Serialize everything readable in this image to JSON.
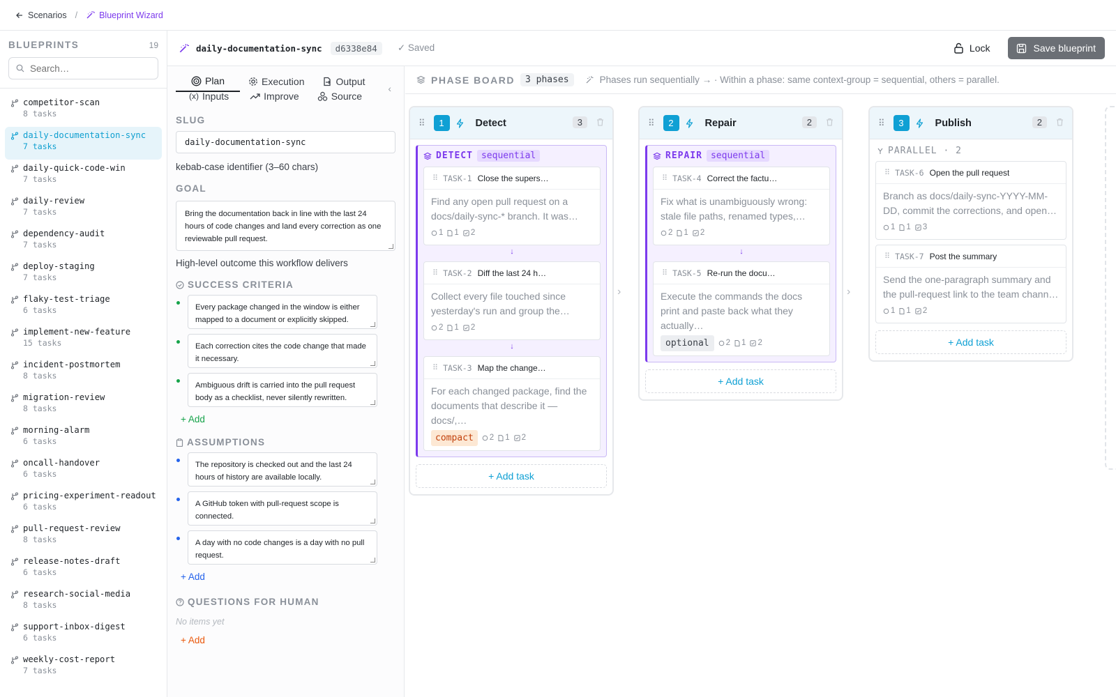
{
  "topbar": {
    "back_label": "Scenarios",
    "separator": "/",
    "current": "Blueprint Wizard"
  },
  "sidebar": {
    "title": "BLUEPRINTS",
    "count": "19",
    "search_placeholder": "Search…",
    "items": [
      {
        "name": "competitor-scan",
        "tasks": "8 tasks"
      },
      {
        "name": "daily-documentation-sync",
        "tasks": "7 tasks",
        "active": true
      },
      {
        "name": "daily-quick-code-win",
        "tasks": "7 tasks"
      },
      {
        "name": "daily-review",
        "tasks": "7 tasks"
      },
      {
        "name": "dependency-audit",
        "tasks": "7 tasks"
      },
      {
        "name": "deploy-staging",
        "tasks": "7 tasks"
      },
      {
        "name": "flaky-test-triage",
        "tasks": "6 tasks"
      },
      {
        "name": "implement-new-feature",
        "tasks": "15 tasks"
      },
      {
        "name": "incident-postmortem",
        "tasks": "8 tasks"
      },
      {
        "name": "migration-review",
        "tasks": "8 tasks"
      },
      {
        "name": "morning-alarm",
        "tasks": "6 tasks"
      },
      {
        "name": "oncall-handover",
        "tasks": "6 tasks"
      },
      {
        "name": "pricing-experiment-readout",
        "tasks": "6 tasks"
      },
      {
        "name": "pull-request-review",
        "tasks": "8 tasks"
      },
      {
        "name": "release-notes-draft",
        "tasks": "6 tasks"
      },
      {
        "name": "research-social-media",
        "tasks": "8 tasks"
      },
      {
        "name": "support-inbox-digest",
        "tasks": "6 tasks"
      },
      {
        "name": "weekly-cost-report",
        "tasks": "7 tasks"
      }
    ]
  },
  "header": {
    "title": "daily-documentation-sync",
    "hash": "d6338e84",
    "saved": "✓ Saved",
    "lock_label": "Lock",
    "save_label": "Save blueprint"
  },
  "tabs": [
    {
      "label": "Plan",
      "icon": "target-icon"
    },
    {
      "label": "Execution",
      "icon": "gear-icon"
    },
    {
      "label": "Output",
      "icon": "output-icon"
    },
    {
      "label": "Inputs",
      "icon": "variable-icon"
    },
    {
      "label": "Improve",
      "icon": "trend-icon"
    },
    {
      "label": "Source",
      "icon": "source-icon"
    }
  ],
  "plan": {
    "slug_label": "SLUG",
    "slug_value": "daily-documentation-sync",
    "slug_help": "kebab-case identifier (3–60 chars)",
    "goal_label": "GOAL",
    "goal_value": "Bring the documentation back in line with the last 24 hours of code changes and land every correction as one reviewable pull request.",
    "goal_help": "High-level outcome this workflow delivers",
    "success_label": "SUCCESS CRITERIA",
    "success": [
      "Every package changed in the window is either mapped to a document or explicitly skipped.",
      "Each correction cites the code change that made it necessary.",
      "Ambiguous drift is carried into the pull request body as a checklist, never silently rewritten."
    ],
    "assumptions_label": "ASSUMPTIONS",
    "assumptions": [
      "The repository is checked out and the last 24 hours of history are available locally.",
      "A GitHub token with pull-request scope is connected.",
      "A day with no code changes is a day with no pull request."
    ],
    "questions_label": "QUESTIONS FOR HUMAN",
    "questions_empty": "No items yet",
    "add_label": "+ Add",
    "colors": {
      "success": "#16a34a",
      "assumptions": "#2563eb",
      "questions": "#ea580c"
    }
  },
  "board": {
    "title": "PHASE BOARD",
    "count": "3 phases",
    "note": "Phases run sequentially → · Within a phase: same context-group = sequential, others = parallel.",
    "add_task": "+ Add task",
    "phases": [
      {
        "num": "1",
        "name": "Detect",
        "count": "3",
        "group": {
          "name": "DETECT",
          "mode": "sequential"
        },
        "tasks": [
          {
            "id": "TASK-1",
            "title": "Close the supers…",
            "body": "Find any open pull request on a docs/daily-sync-* branch. It was…",
            "m1": "1",
            "m2": "1",
            "m3": "2"
          },
          {
            "id": "TASK-2",
            "title": "Diff the last 24 h…",
            "body": "Collect every file touched since yesterday's run and group the…",
            "m1": "2",
            "m2": "1",
            "m3": "2"
          },
          {
            "id": "TASK-3",
            "title": "Map the change…",
            "body": "For each changed package, find the documents that describe it — docs/,…",
            "tag": "compact",
            "m1": "2",
            "m2": "1",
            "m3": "2"
          }
        ]
      },
      {
        "num": "2",
        "name": "Repair",
        "count": "2",
        "group": {
          "name": "REPAIR",
          "mode": "sequential"
        },
        "tasks": [
          {
            "id": "TASK-4",
            "title": "Correct the factu…",
            "body": "Fix what is unambiguously wrong: stale file paths, renamed types,…",
            "m1": "2",
            "m2": "1",
            "m3": "2"
          },
          {
            "id": "TASK-5",
            "title": "Re-run the docu…",
            "body": "Execute the commands the docs print and paste back what they actually…",
            "tag": "optional",
            "m1": "2",
            "m2": "1",
            "m3": "2"
          }
        ]
      },
      {
        "num": "3",
        "name": "Publish",
        "count": "2",
        "parallel": "PARALLEL · 2",
        "tasks": [
          {
            "id": "TASK-6",
            "title": "Open the pull request",
            "body": "Branch as docs/daily-sync-YYYY-MM-DD, commit the corrections, and open…",
            "m1": "1",
            "m2": "1",
            "m3": "3"
          },
          {
            "id": "TASK-7",
            "title": "Post the summary",
            "body": "Send the one-paragraph summary and the pull-request link to the team chann…",
            "m1": "1",
            "m2": "1",
            "m3": "2"
          }
        ]
      }
    ]
  }
}
